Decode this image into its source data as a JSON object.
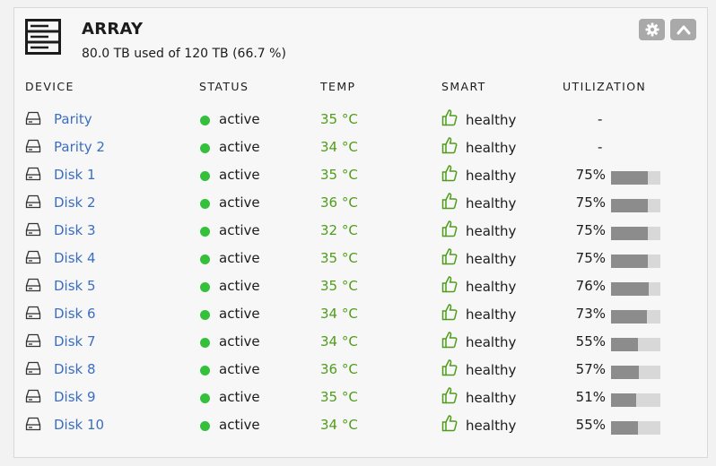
{
  "header": {
    "title": "ARRAY",
    "subtitle": "80.0 TB used of 120 TB (66.7 %)"
  },
  "columns": {
    "device": "DEVICE",
    "status": "STATUS",
    "temp": "TEMP",
    "smart": "SMART",
    "utilization": "UTILIZATION"
  },
  "colors": {
    "link": "#3b6ec1",
    "temp": "#4f9d1a",
    "status_active": "#34c03a",
    "bar_fill": "#8c8c8c",
    "bar_track": "#d8d8d8"
  },
  "devices": [
    {
      "name": "Parity",
      "status": "active",
      "temp": "35 °C",
      "smart": "healthy",
      "utilization_text": "-",
      "utilization": null
    },
    {
      "name": "Parity 2",
      "status": "active",
      "temp": "34 °C",
      "smart": "healthy",
      "utilization_text": "-",
      "utilization": null
    },
    {
      "name": "Disk 1",
      "status": "active",
      "temp": "35 °C",
      "smart": "healthy",
      "utilization_text": "75%",
      "utilization": 75
    },
    {
      "name": "Disk 2",
      "status": "active",
      "temp": "36 °C",
      "smart": "healthy",
      "utilization_text": "75%",
      "utilization": 75
    },
    {
      "name": "Disk 3",
      "status": "active",
      "temp": "32 °C",
      "smart": "healthy",
      "utilization_text": "75%",
      "utilization": 75
    },
    {
      "name": "Disk 4",
      "status": "active",
      "temp": "35 °C",
      "smart": "healthy",
      "utilization_text": "75%",
      "utilization": 75
    },
    {
      "name": "Disk 5",
      "status": "active",
      "temp": "35 °C",
      "smart": "healthy",
      "utilization_text": "76%",
      "utilization": 76
    },
    {
      "name": "Disk 6",
      "status": "active",
      "temp": "34 °C",
      "smart": "healthy",
      "utilization_text": "73%",
      "utilization": 73
    },
    {
      "name": "Disk 7",
      "status": "active",
      "temp": "34 °C",
      "smart": "healthy",
      "utilization_text": "55%",
      "utilization": 55
    },
    {
      "name": "Disk 8",
      "status": "active",
      "temp": "36 °C",
      "smart": "healthy",
      "utilization_text": "57%",
      "utilization": 57
    },
    {
      "name": "Disk 9",
      "status": "active",
      "temp": "35 °C",
      "smart": "healthy",
      "utilization_text": "51%",
      "utilization": 51
    },
    {
      "name": "Disk 10",
      "status": "active",
      "temp": "34 °C",
      "smart": "healthy",
      "utilization_text": "55%",
      "utilization": 55
    }
  ]
}
